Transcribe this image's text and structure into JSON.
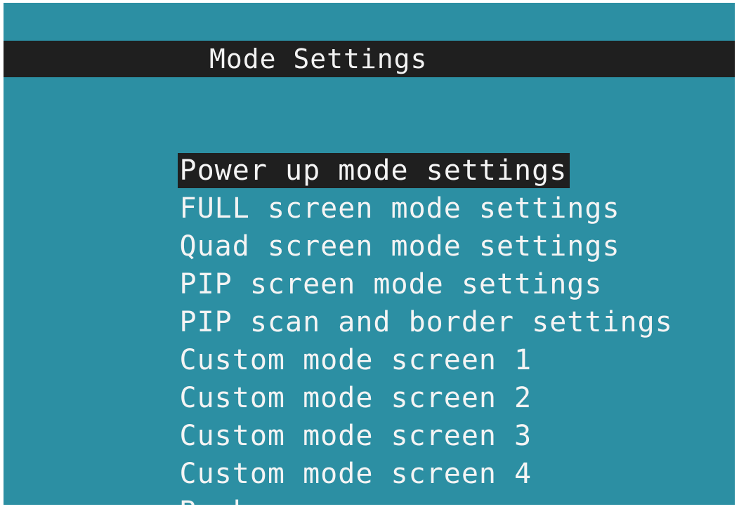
{
  "header": {
    "title": "Mode Settings"
  },
  "menu": {
    "selected_index": 0,
    "items": [
      {
        "label": "Power up mode settings"
      },
      {
        "label": "FULL screen mode settings"
      },
      {
        "label": "Quad screen mode settings"
      },
      {
        "label": "PIP screen mode settings"
      },
      {
        "label": "PIP scan and border settings"
      },
      {
        "label": "Custom mode screen 1"
      },
      {
        "label": "Custom mode screen 2"
      },
      {
        "label": "Custom mode screen 3"
      },
      {
        "label": "Custom mode screen 4"
      },
      {
        "label": "Back"
      }
    ]
  },
  "colors": {
    "background": "#2c8fa3",
    "bar": "#1f1f1f",
    "text": "#f4f4f4"
  }
}
